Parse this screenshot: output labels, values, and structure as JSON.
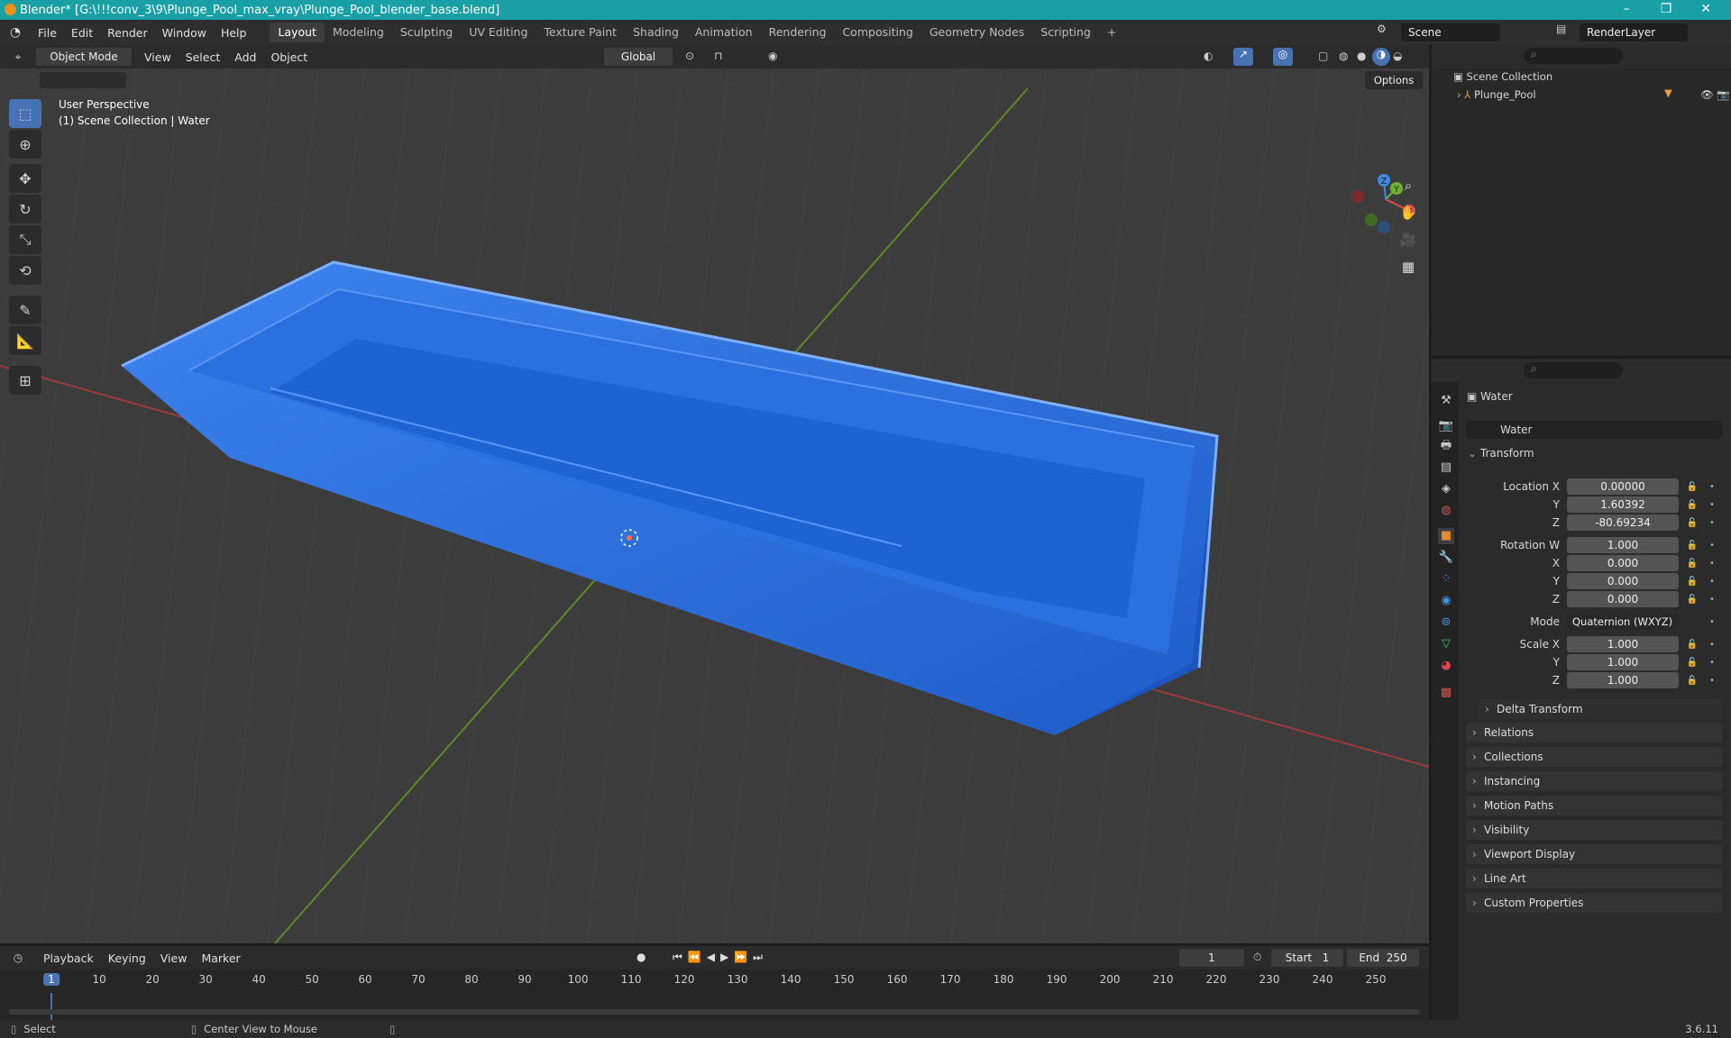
{
  "window": {
    "title": "Blender* [G:\\!!!conv_3\\9\\Plunge_Pool_max_vray\\Plunge_Pool_blender_base.blend]"
  },
  "menus": [
    "File",
    "Edit",
    "Render",
    "Window",
    "Help"
  ],
  "workspaces": [
    "Layout",
    "Modeling",
    "Sculpting",
    "UV Editing",
    "Texture Paint",
    "Shading",
    "Animation",
    "Rendering",
    "Compositing",
    "Geometry Nodes",
    "Scripting"
  ],
  "active_workspace": "Layout",
  "scene": "Scene",
  "render_layer": "RenderLayer",
  "viewport": {
    "mode": "Object Mode",
    "menus": [
      "View",
      "Select",
      "Add",
      "Object"
    ],
    "orientation": "Global",
    "options": "Options",
    "perspective": "User Perspective",
    "collection_info": "(1) Scene Collection | Water",
    "gizmo": {
      "x": "X",
      "y": "Y",
      "z": "Z"
    }
  },
  "outliner": {
    "root": "Scene Collection",
    "items": [
      {
        "name": "Plunge_Pool"
      }
    ]
  },
  "properties": {
    "object_name": "Water",
    "data_name": "Water",
    "transform_title": "Transform",
    "location": {
      "label": "Location X",
      "x": "0.00000",
      "y": "1.60392",
      "z": "-80.69234"
    },
    "rotation": {
      "label": "Rotation W",
      "w": "1.000",
      "x": "0.000",
      "y": "0.000",
      "z": "0.000"
    },
    "mode": {
      "label": "Mode",
      "value": "Quaternion (WXYZ)"
    },
    "scale": {
      "label": "Scale X",
      "x": "1.000",
      "y": "1.000",
      "z": "1.000"
    },
    "axis": {
      "y": "Y",
      "x": "X",
      "z": "Z"
    },
    "delta": "Delta Transform",
    "sections": [
      "Relations",
      "Collections",
      "Instancing",
      "Motion Paths",
      "Visibility",
      "Viewport Display",
      "Line Art",
      "Custom Properties"
    ]
  },
  "timeline": {
    "menus": [
      "Playback",
      "Keying",
      "View",
      "Marker"
    ],
    "current_frame": "1",
    "start_label": "Start",
    "start": "1",
    "end_label": "End",
    "end": "250",
    "ticks": [
      "1",
      "10",
      "20",
      "30",
      "40",
      "50",
      "60",
      "70",
      "80",
      "90",
      "100",
      "110",
      "120",
      "130",
      "140",
      "150",
      "160",
      "170",
      "180",
      "190",
      "200",
      "210",
      "220",
      "230",
      "240",
      "250"
    ]
  },
  "status": {
    "select": "Select",
    "center": "Center View to Mouse",
    "version": "3.6.11"
  },
  "colors": {
    "titlebar": "#19a0a5",
    "accent": "#4772b3",
    "pool": "#2f6fd6"
  }
}
